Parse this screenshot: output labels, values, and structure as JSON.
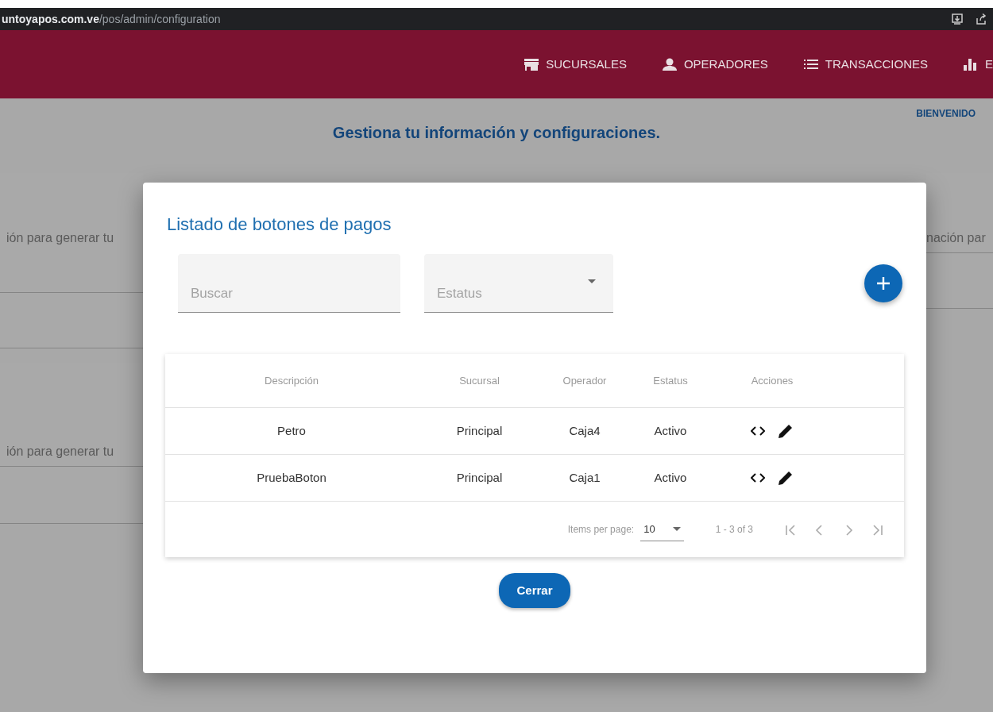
{
  "browser": {
    "url_host": "untoyapos.com.ve",
    "url_path": "/pos/admin/configuration"
  },
  "nav": {
    "items": [
      {
        "label": "SUCURSALES",
        "kind": "store"
      },
      {
        "label": "OPERADORES",
        "kind": "person"
      },
      {
        "label": "TRANSACCIONES",
        "kind": "list"
      },
      {
        "label": "E",
        "kind": "chart"
      }
    ]
  },
  "page": {
    "welcome": "BIENVENIDO",
    "heading": "Gestiona tu información y configuraciones.",
    "left_cards": [
      {
        "text": "ión para generar tu"
      },
      {
        "text": "ión para generar tu"
      }
    ],
    "right_cards": [
      {
        "text": "nación par"
      }
    ]
  },
  "dialog": {
    "title": "Listado de botones de pagos",
    "search": {
      "placeholder": "Buscar"
    },
    "status_filter": {
      "placeholder": "Estatus"
    },
    "table": {
      "columns": [
        "Descripción",
        "Sucursal",
        "Operador",
        "Estatus",
        "Acciones"
      ],
      "rows": [
        {
          "cells": [
            "Petro",
            "Principal",
            "Caja4",
            "Activo"
          ]
        },
        {
          "cells": [
            "PruebaBoton",
            "Principal",
            "Caja1",
            "Activo"
          ]
        }
      ]
    },
    "paginator": {
      "label": "Items per page:",
      "page_size": "10",
      "range": "1 - 3 of 3"
    },
    "close_button": "Cerrar"
  }
}
